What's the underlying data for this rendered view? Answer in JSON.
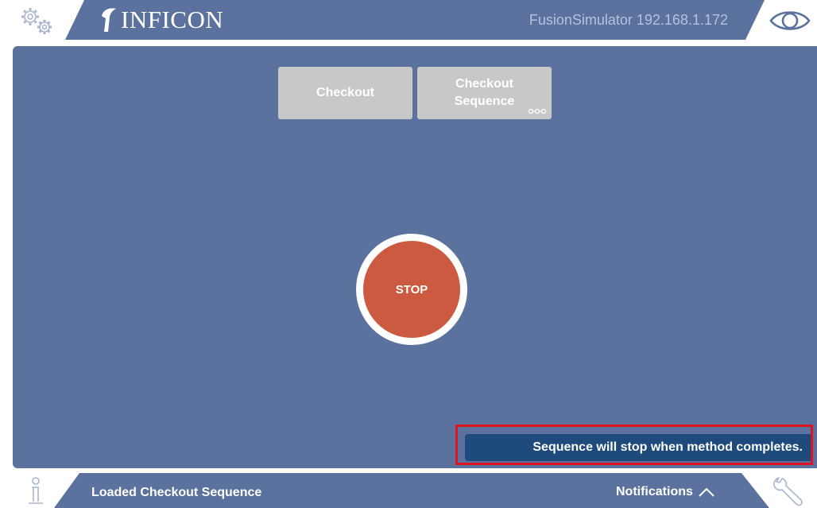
{
  "header": {
    "brand": "INFICON",
    "device_label": "FusionSimulator 192.168.1.172",
    "icons": {
      "settings": "gears-icon",
      "view": "eye-icon"
    }
  },
  "main": {
    "mode_buttons": [
      {
        "label": "Checkout"
      },
      {
        "label_line1": "Checkout",
        "label_line2": "Sequence",
        "icon": "sequence-dots-icon"
      }
    ],
    "stop_button": {
      "label": "STOP"
    },
    "status_message": "Sequence will stop when method completes."
  },
  "footer": {
    "loaded_text": "Loaded  Checkout Sequence",
    "notifications_label": "Notifications",
    "icons": {
      "info": "info-icon",
      "tools": "wrench-icon",
      "expand": "chevron-up-icon"
    }
  },
  "colors": {
    "panel": "#5c729e",
    "bar": "#5c729e",
    "button": "#c8c8c8",
    "stop": "#cc5a40",
    "message": "#1e4a7c",
    "highlight": "#e0141e"
  }
}
